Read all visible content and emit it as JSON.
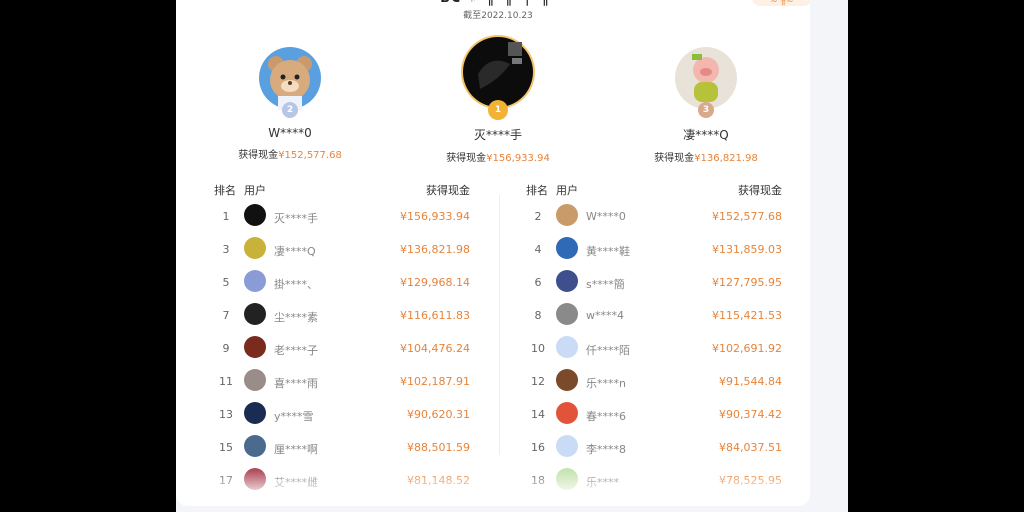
{
  "header": {
    "title_partial": "ьс ♯ ╫ ╗ ╪ ╥",
    "subtitle": "截至2022.10.23",
    "badge": "≈ ╫≈"
  },
  "podium": [
    {
      "rank": "2",
      "name": "W****0",
      "cash_label": "获得现金",
      "cash": "¥152,577.68",
      "avatar": "bear-avatar",
      "medal_color": "#b8c6e6"
    },
    {
      "rank": "1",
      "name": "灭****手",
      "cash_label": "获得现金",
      "cash": "¥156,933.94",
      "avatar": "dark-avatar",
      "medal_color": "#f2b233"
    },
    {
      "rank": "3",
      "name": "凄****Q",
      "cash_label": "获得现金",
      "cash": "¥136,821.98",
      "avatar": "pig-avatar",
      "medal_color": "#d9a98c"
    }
  ],
  "table": {
    "headers": {
      "rank": "排名",
      "user": "用户",
      "cash": "获得现金"
    },
    "left": [
      {
        "rank": "1",
        "user": "灭****手",
        "cash": "¥156,933.94",
        "color": "#111"
      },
      {
        "rank": "3",
        "user": "凄****Q",
        "cash": "¥136,821.98",
        "color": "#c9b23a"
      },
      {
        "rank": "5",
        "user": "掛****、",
        "cash": "¥129,968.14",
        "color": "#8a9bd6"
      },
      {
        "rank": "7",
        "user": "尘****素",
        "cash": "¥116,611.83",
        "color": "#222"
      },
      {
        "rank": "9",
        "user": "老****子",
        "cash": "¥104,476.24",
        "color": "#7a2b1e"
      },
      {
        "rank": "11",
        "user": "喜****雨",
        "cash": "¥102,187.91",
        "color": "#9a8c88"
      },
      {
        "rank": "13",
        "user": "y****雪",
        "cash": "¥90,620.31",
        "color": "#1b2c52"
      },
      {
        "rank": "15",
        "user": "厘****啊",
        "cash": "¥88,501.59",
        "color": "#4a6a8e"
      },
      {
        "rank": "17",
        "user": "艾****雌",
        "cash": "¥81,148.52",
        "color": "#b04a5a"
      }
    ],
    "right": [
      {
        "rank": "2",
        "user": "W****0",
        "cash": "¥152,577.68",
        "color": "#c99a6a"
      },
      {
        "rank": "4",
        "user": "黄****鞋",
        "cash": "¥131,859.03",
        "color": "#2f6ab6"
      },
      {
        "rank": "6",
        "user": "s****簡",
        "cash": "¥127,795.95",
        "color": "#3f4f8e"
      },
      {
        "rank": "8",
        "user": "w****4",
        "cash": "¥115,421.53",
        "color": "#8a8a8a"
      },
      {
        "rank": "10",
        "user": "仟****陌",
        "cash": "¥102,691.92",
        "color": "#c9dbf5"
      },
      {
        "rank": "12",
        "user": "乐****n",
        "cash": "¥91,544.84",
        "color": "#7a4a2a"
      },
      {
        "rank": "14",
        "user": "春****6",
        "cash": "¥90,374.42",
        "color": "#e2543a"
      },
      {
        "rank": "16",
        "user": "李****8",
        "cash": "¥84,037.51",
        "color": "#c9dbf5"
      },
      {
        "rank": "18",
        "user": "乐****",
        "cash": "¥78,525.95",
        "color": "#c6e3b0"
      }
    ]
  }
}
